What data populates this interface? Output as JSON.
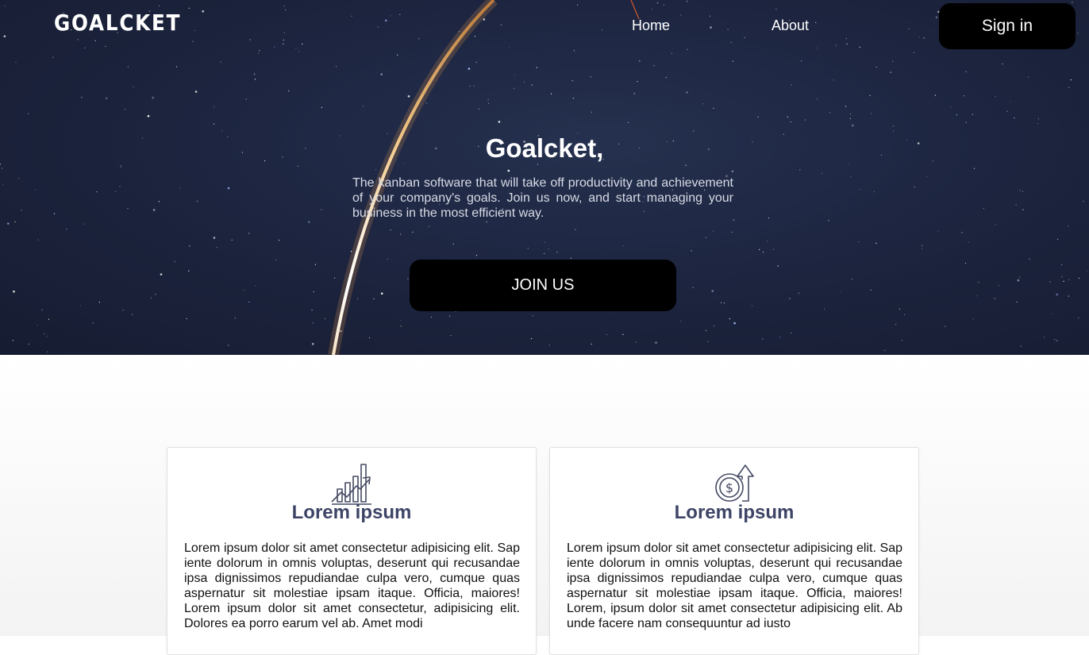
{
  "header": {
    "logo": "GOALCKET",
    "nav": [
      {
        "label": "Home"
      },
      {
        "label": "About"
      }
    ],
    "signin_label": "Sign in"
  },
  "hero": {
    "title": "Goalcket,",
    "description": "The kanban software that will take off productivity and achievement of your company's goals. Join us now, and start managing your business in the most efficient way.",
    "cta_label": "JOIN US"
  },
  "cards": [
    {
      "icon": "growth-chart-icon",
      "title": "Lorem ipsum",
      "text": "Lorem ipsum dolor sit amet consectetur adipisicing elit. Sap iente dolorum in omnis voluptas, deserunt qui recusandae ipsa dignissimos repudiandae culpa vero, cumque quas aspernatur sit molestiae ipsam itaque. Officia, maiores! Lorem ipsum dolor sit amet consectetur, adipisicing elit. Dolores ea porro earum vel ab. Amet modi"
    },
    {
      "icon": "dollar-coin-up-icon",
      "title": "Lorem ipsum",
      "text": "Lorem ipsum dolor sit amet consectetur adipisicing elit. Sap iente dolorum in omnis voluptas, deserunt qui recusandae ipsa dignissimos repudiandae culpa vero, cumque quas aspernatur sit molestiae ipsam itaque. Officia, maiores! Lorem, ipsum dolor sit amet consectetur adipisicing elit. Ab unde facere nam consequuntur ad iusto"
    }
  ],
  "colors": {
    "hero_bg": "#1d2540",
    "button_bg": "#000000",
    "card_title": "#3d4466",
    "icon_stroke": "#444a63"
  }
}
